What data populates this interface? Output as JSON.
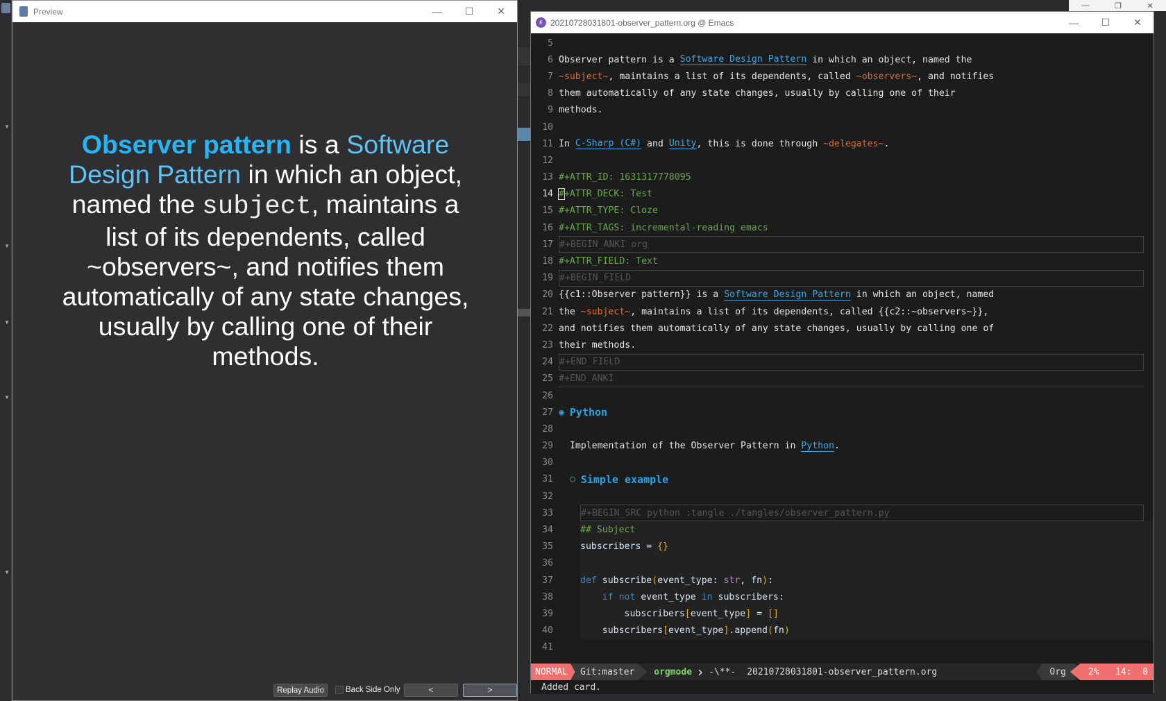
{
  "preview": {
    "title": "Preview",
    "card": {
      "bold": "Observer pattern",
      "t1": " is a ",
      "link": "Software Design Pattern",
      "t2": " in which an object, named the ",
      "mono": "subject",
      "t3": ", maintains a list of its dependents, called ~observers~, and notifies them automatically of any state changes, usually by calling one of their methods."
    },
    "buttons": {
      "replay": "Replay Audio",
      "back_side_only": "Back Side Only",
      "back_side_only_checked": false,
      "prev": "<",
      "next": ">"
    }
  },
  "emacs": {
    "title": "20210728031801-observer_pattern.org @ Emacs",
    "lines": [
      {
        "n": "5",
        "s": []
      },
      {
        "n": "6",
        "s": [
          {
            "t": "Observer pattern is a "
          },
          {
            "t": "Software Design Pattern",
            "c": "l"
          },
          {
            "t": " in which an object, named the"
          }
        ]
      },
      {
        "n": "7",
        "s": [
          {
            "t": "~subject~",
            "c": "c"
          },
          {
            "t": ", maintains a list of its dependents, called "
          },
          {
            "t": "~observers~",
            "c": "c"
          },
          {
            "t": ", and notifies"
          }
        ]
      },
      {
        "n": "8",
        "s": [
          {
            "t": "them automatically of any state changes, usually by calling one of their"
          }
        ]
      },
      {
        "n": "9",
        "s": [
          {
            "t": "methods."
          }
        ]
      },
      {
        "n": "10",
        "s": []
      },
      {
        "n": "11",
        "s": [
          {
            "t": "In "
          },
          {
            "t": "C-Sharp (C#)",
            "c": "l"
          },
          {
            "t": " and "
          },
          {
            "t": "Unity",
            "c": "l"
          },
          {
            "t": ", this is done through "
          },
          {
            "t": "~delegates~",
            "c": "c"
          },
          {
            "t": "."
          }
        ]
      },
      {
        "n": "12",
        "s": []
      },
      {
        "n": "13",
        "s": [
          {
            "t": "#+ATTR_ID: 1631317778095",
            "c": "k"
          }
        ]
      },
      {
        "n": "14",
        "cur": true,
        "s": [
          {
            "t": "#",
            "c": "k cursor"
          },
          {
            "t": "+ATTR_DECK: Test",
            "c": "k"
          }
        ]
      },
      {
        "n": "15",
        "s": [
          {
            "t": "#+ATTR_TYPE: Cloze",
            "c": "k"
          }
        ]
      },
      {
        "n": "16",
        "s": [
          {
            "t": "#+ATTR_TAGS: incremental-reading emacs",
            "c": "k"
          }
        ]
      },
      {
        "n": "17",
        "box": true,
        "s": [
          {
            "t": "#+BEGIN_ANKI org",
            "c": "d"
          }
        ]
      },
      {
        "n": "18",
        "s": [
          {
            "t": "#+ATTR_FIELD: Text",
            "c": "k"
          }
        ]
      },
      {
        "n": "19",
        "box": true,
        "s": [
          {
            "t": "#+BEGIN_FIELD",
            "c": "d"
          }
        ]
      },
      {
        "n": "20",
        "s": [
          {
            "t": "{{c1::Observer pattern}} is a "
          },
          {
            "t": "Software Design Pattern",
            "c": "l"
          },
          {
            "t": " in which an object, named"
          }
        ]
      },
      {
        "n": "21",
        "s": [
          {
            "t": "the "
          },
          {
            "t": "~subject~",
            "c": "c"
          },
          {
            "t": ", maintains a list of its dependents, called {{c2::~observers~}},"
          }
        ]
      },
      {
        "n": "22",
        "s": [
          {
            "t": "and notifies them automatically of any state changes, usually by calling one of"
          }
        ]
      },
      {
        "n": "23",
        "s": [
          {
            "t": "their methods."
          }
        ]
      },
      {
        "n": "24",
        "box": true,
        "s": [
          {
            "t": "#+END_FIELD",
            "c": "d"
          }
        ]
      },
      {
        "n": "25",
        "under": true,
        "s": [
          {
            "t": "#+END_ANKI",
            "c": "d"
          }
        ]
      },
      {
        "n": "26",
        "s": []
      },
      {
        "n": "27",
        "s": [
          {
            "t": "◉ ",
            "c": "b"
          },
          {
            "t": "Python",
            "c": "h1"
          }
        ]
      },
      {
        "n": "28",
        "s": []
      },
      {
        "n": "29",
        "s": [
          {
            "t": "  Implementation of the Observer Pattern in "
          },
          {
            "t": "Python",
            "c": "l"
          },
          {
            "t": "."
          }
        ]
      },
      {
        "n": "30",
        "s": []
      },
      {
        "n": "31",
        "s": [
          {
            "t": "  ○ ",
            "c": "b"
          },
          {
            "t": "Simple example",
            "c": "h2"
          }
        ]
      },
      {
        "n": "32",
        "s": []
      },
      {
        "n": "33",
        "indent": true,
        "box": true,
        "s": [
          {
            "t": "#+BEGIN_SRC python :tangle ./tangles/observer_pattern.py",
            "c": "d"
          }
        ]
      },
      {
        "n": "34",
        "indent": true,
        "code": true,
        "s": [
          {
            "t": "## Subject",
            "c": "cm"
          }
        ]
      },
      {
        "n": "35",
        "indent": true,
        "code": true,
        "s": [
          {
            "t": "subscribers = ",
            "c": "cd"
          },
          {
            "t": "{}",
            "c": "y"
          }
        ]
      },
      {
        "n": "36",
        "indent": true,
        "code": true,
        "s": []
      },
      {
        "n": "37",
        "indent": true,
        "code": true,
        "s": [
          {
            "t": "def",
            "c": "kw"
          },
          {
            "t": " subscribe",
            "c": "cd"
          },
          {
            "t": "(",
            "c": "y"
          },
          {
            "t": "event_type: ",
            "c": "cd"
          },
          {
            "t": "str",
            "c": "s"
          },
          {
            "t": ", fn",
            "c": "cd"
          },
          {
            "t": ")",
            "c": "y"
          },
          {
            "t": ":",
            "c": "cd"
          }
        ]
      },
      {
        "n": "38",
        "indent": true,
        "code": true,
        "s": [
          {
            "t": "    "
          },
          {
            "t": "if not",
            "c": "kw"
          },
          {
            "t": " event_type ",
            "c": "cd"
          },
          {
            "t": "in",
            "c": "kw"
          },
          {
            "t": " subscribers:",
            "c": "cd"
          }
        ]
      },
      {
        "n": "39",
        "indent": true,
        "code": true,
        "s": [
          {
            "t": "        subscribers",
            "c": "cd"
          },
          {
            "t": "[",
            "c": "y"
          },
          {
            "t": "event_type",
            "c": "cd"
          },
          {
            "t": "]",
            "c": "y"
          },
          {
            "t": " = ",
            "c": "cd"
          },
          {
            "t": "[]",
            "c": "y"
          }
        ]
      },
      {
        "n": "40",
        "indent": true,
        "code": true,
        "s": [
          {
            "t": "    subscribers",
            "c": "cd"
          },
          {
            "t": "[",
            "c": "y"
          },
          {
            "t": "event_type",
            "c": "cd"
          },
          {
            "t": "]",
            "c": "y"
          },
          {
            "t": ".append",
            "c": "cd"
          },
          {
            "t": "(",
            "c": "y"
          },
          {
            "t": "fn",
            "c": "cd"
          },
          {
            "t": ")",
            "c": "y"
          }
        ]
      },
      {
        "n": "41",
        "s": []
      }
    ],
    "modeline": {
      "evil_state": "NORMAL",
      "git": "Git:master",
      "mode": "orgmode",
      "modified": "-\\**-",
      "buffer": "20210728031801-observer_pattern.org",
      "major_mode": "Org",
      "position": "2%   14:  0"
    },
    "echo": "Added card.",
    "colors": {
      "accent_red": "#f07070",
      "link": "#3fa6e4",
      "keyword": "#6aa84f",
      "code": "#d8703e"
    }
  }
}
